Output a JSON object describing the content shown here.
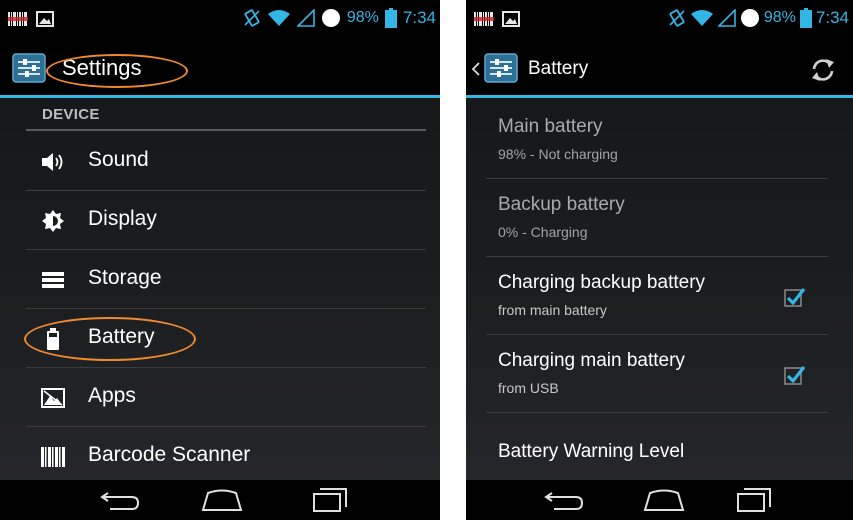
{
  "status_bar": {
    "battery_percent": "98%",
    "time": "7:34"
  },
  "settings_screen": {
    "title": "Settings",
    "section_header": "DEVICE",
    "items": [
      {
        "label": "Sound",
        "icon": "speaker-icon"
      },
      {
        "label": "Display",
        "icon": "brightness-icon"
      },
      {
        "label": "Storage",
        "icon": "storage-icon"
      },
      {
        "label": "Battery",
        "icon": "battery-icon"
      },
      {
        "label": "Apps",
        "icon": "apps-icon"
      },
      {
        "label": "Barcode Scanner",
        "icon": "barcode-icon"
      }
    ]
  },
  "battery_screen": {
    "title": "Battery",
    "items": [
      {
        "title": "Main battery",
        "summary": "98% - Not charging",
        "enabled": false
      },
      {
        "title": "Backup battery",
        "summary": "0% - Charging",
        "enabled": false
      },
      {
        "title": "Charging backup battery",
        "summary": "from main battery",
        "checked": true
      },
      {
        "title": "Charging main battery",
        "summary": "from USB",
        "checked": true
      },
      {
        "title": "Battery Warning Level",
        "summary": ""
      }
    ]
  },
  "colors": {
    "accent": "#33b5e5",
    "highlight": "#f08a2c",
    "background": "#1b1d1f"
  }
}
